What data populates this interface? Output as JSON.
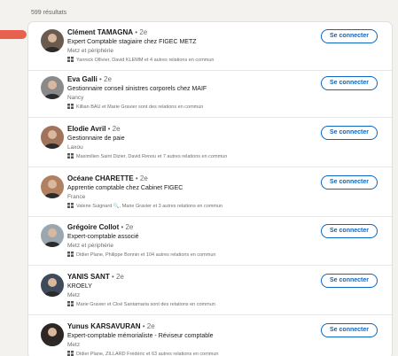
{
  "results_count": "599 résultats",
  "connect_label": "Se connecter",
  "accent_color": "#0a66c2",
  "people": [
    {
      "name": "Clément TAMAGNA",
      "degree": " • 2e",
      "headline": "Expert Comptable stagiaire chez FIGEC METZ",
      "location": "Metz et périphérie",
      "mutual": "Yannick Ollivier, David KLEMM et 4 autres relations en commun",
      "avatar_bg": "#6b5a4e"
    },
    {
      "name": "Eva Galli",
      "degree": " • 2e",
      "headline": "Gestionnaire conseil sinistres corporels chez MAIF",
      "location": "Nancy",
      "mutual": "Killian BAU et Marie Gravier sont des relations en commun",
      "avatar_bg": "#8a8a8a"
    },
    {
      "name": "Elodie Avril",
      "degree": " • 2e",
      "headline": "Gestionnaire de paie",
      "location": "Laxou",
      "mutual": "Maximilien Saint Dizier, David Renou et 7 autres relations en commun",
      "avatar_bg": "#a0735a"
    },
    {
      "name": "Océane CHARETTE",
      "degree": " • 2e",
      "headline": "Apprentie comptable chez Cabinet FIGEC",
      "location": "France",
      "mutual": "Valerie Suignard 🔍, Marie Gravier et 3 autres relations en commun",
      "avatar_bg": "#b08060"
    },
    {
      "name": "Grégoire Collot",
      "degree": " • 2e",
      "headline": "Expert-comptable associé",
      "location": "Metz et périphérie",
      "mutual": "Didier Plane, Philippe Bonnin et 104 autres relations en commun",
      "avatar_bg": "#9aa7b0"
    },
    {
      "name": "YANIS SANT",
      "degree": " • 2e",
      "headline": "KROELY",
      "location": "Metz",
      "mutual": "Marie Gravier et Cloé Santamaria sont des relations en commun",
      "avatar_bg": "#3f4a5a"
    },
    {
      "name": "Yunus KARSAVURAN",
      "degree": " • 2e",
      "headline": "Expert-comptable mémorialiste - Réviseur comptable",
      "location": "Metz",
      "mutual": "Didier Plane, ZILLARD Frédéric et 63 autres relations en commun",
      "avatar_bg": "#2e2622"
    }
  ]
}
